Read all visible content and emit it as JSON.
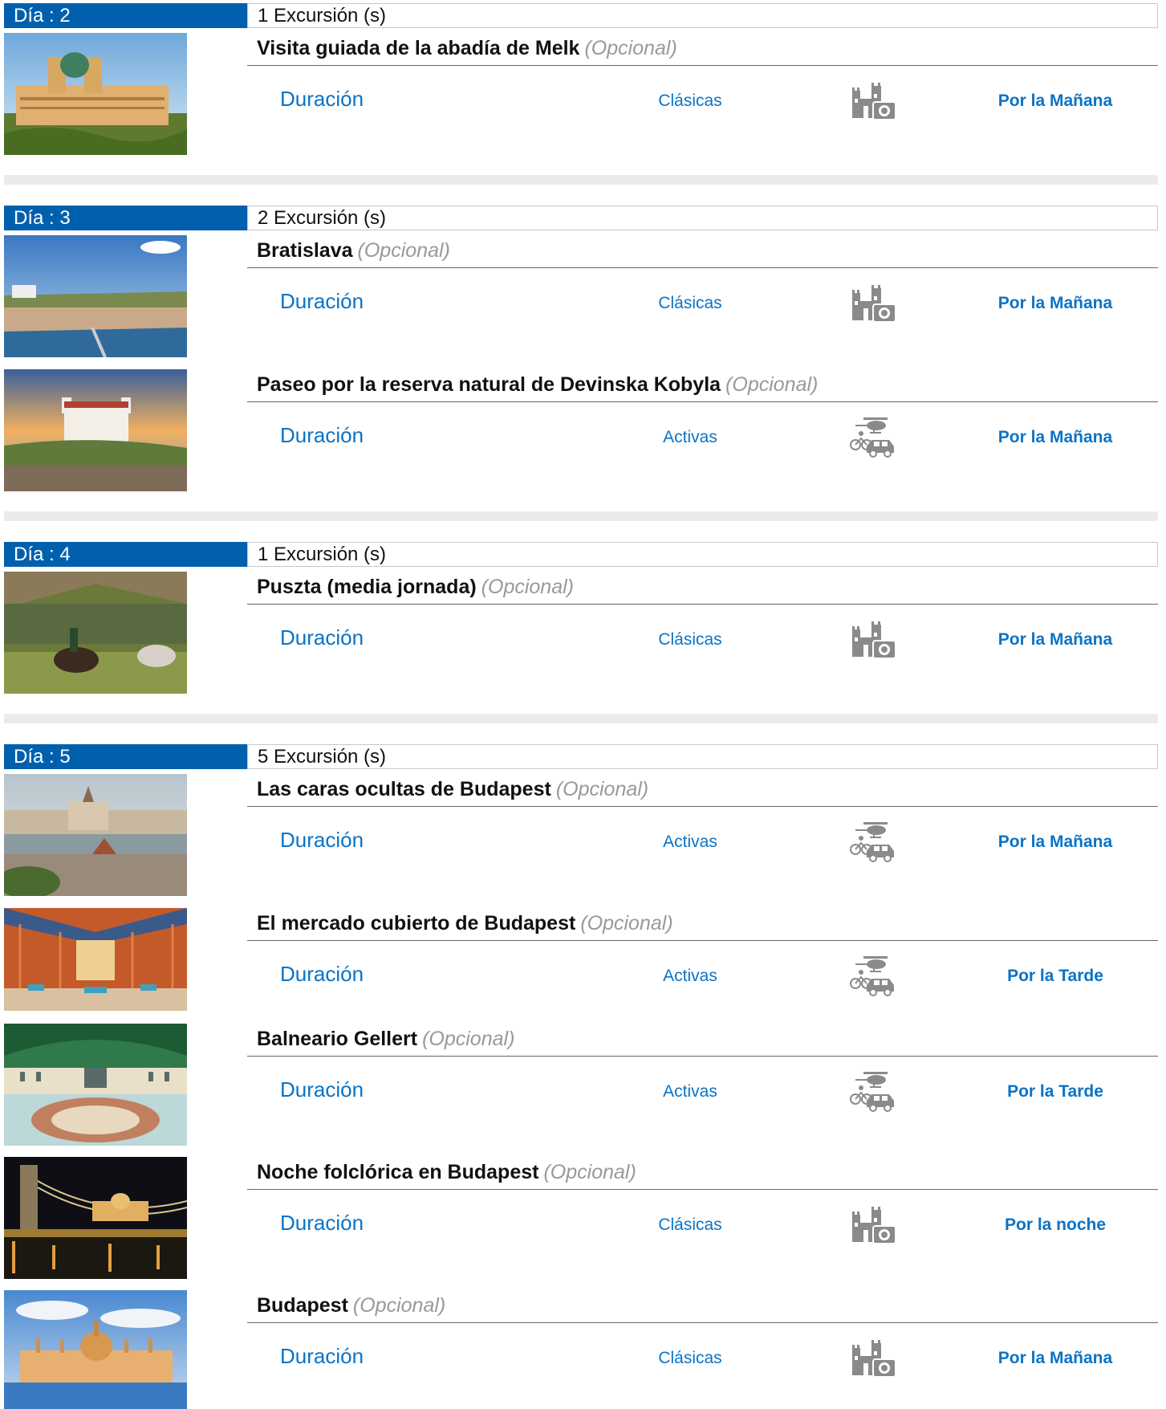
{
  "days": [
    {
      "label": "Día : 2",
      "count": "1 Excursión (s)",
      "excursions": [
        {
          "title": "Visita guiada de la abadía de Melk",
          "optional": "(Opcional)",
          "duration": "Duración",
          "category": "Clásicas",
          "category_icon": "castle-camera-icon",
          "time": "Por la Mañana"
        }
      ]
    },
    {
      "label": "Día : 3",
      "count": "2 Excursión (s)",
      "excursions": [
        {
          "title": "Bratislava",
          "optional": "(Opcional)",
          "duration": "Duración",
          "category": "Clásicas",
          "category_icon": "castle-camera-icon",
          "time": "Por la Mañana"
        },
        {
          "title": "Paseo por la reserva natural de Devinska Kobyla",
          "optional": "(Opcional)",
          "duration": "Duración",
          "category": "Activas",
          "category_icon": "helicopter-bike-car-icon",
          "time": "Por la Mañana"
        }
      ]
    },
    {
      "label": "Día : 4",
      "count": "1 Excursión (s)",
      "excursions": [
        {
          "title": "Puszta (media jornada)",
          "optional": "(Opcional)",
          "duration": "Duración",
          "category": "Clásicas",
          "category_icon": "castle-camera-icon",
          "time": "Por la Mañana"
        }
      ]
    },
    {
      "label": "Día : 5",
      "count": "5 Excursión (s)",
      "excursions": [
        {
          "title": "Las caras ocultas de Budapest",
          "optional": "(Opcional)",
          "duration": "Duración",
          "category": "Activas",
          "category_icon": "helicopter-bike-car-icon",
          "time": "Por la Mañana"
        },
        {
          "title": "El mercado cubierto de Budapest",
          "optional": "(Opcional)",
          "duration": "Duración",
          "category": "Activas",
          "category_icon": "helicopter-bike-car-icon",
          "time": "Por la Tarde"
        },
        {
          "title": "Balneario Gellert",
          "optional": "(Opcional)",
          "duration": "Duración",
          "category": "Activas",
          "category_icon": "helicopter-bike-car-icon",
          "time": "Por la Tarde"
        },
        {
          "title": "Noche folclórica en Budapest",
          "optional": "(Opcional)",
          "duration": "Duración",
          "category": "Clásicas",
          "category_icon": "castle-camera-icon",
          "time": "Por la noche"
        },
        {
          "title": "Budapest",
          "optional": "(Opcional)",
          "duration": "Duración",
          "category": "Clásicas",
          "category_icon": "castle-camera-icon",
          "time": "Por la Mañana"
        }
      ]
    }
  ],
  "colors": {
    "accent": "#0060ae",
    "link": "#0a73c6",
    "optional_text": "#999999",
    "separator": "#ebebeb"
  }
}
